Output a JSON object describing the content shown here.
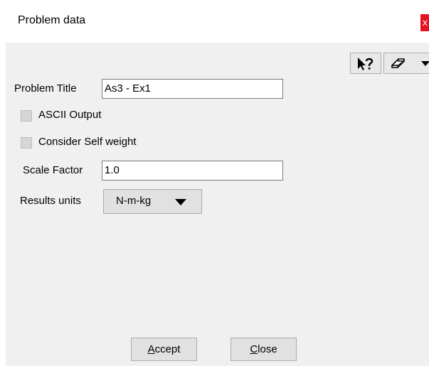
{
  "window": {
    "title": "Problem data",
    "close_label": "x"
  },
  "toolbar": {
    "help_icon": "context-help-icon",
    "erase_icon": "eraser-icon",
    "dropdown_icon": "chevron-down-icon"
  },
  "form": {
    "problem_title_label": "Problem Title",
    "problem_title_value": "As3 - Ex1",
    "ascii_output_label": "ASCII Output",
    "ascii_output_checked": false,
    "self_weight_label": "Consider Self weight",
    "self_weight_checked": false,
    "scale_factor_label": "Scale Factor",
    "scale_factor_value": "1.0",
    "results_units_label": "Results units",
    "results_units_value": "N-m-kg"
  },
  "buttons": {
    "accept_label": "Accept",
    "close_label": "Close"
  },
  "colors": {
    "window_bg": "#f0f0f0",
    "close_button": "#e81123"
  }
}
